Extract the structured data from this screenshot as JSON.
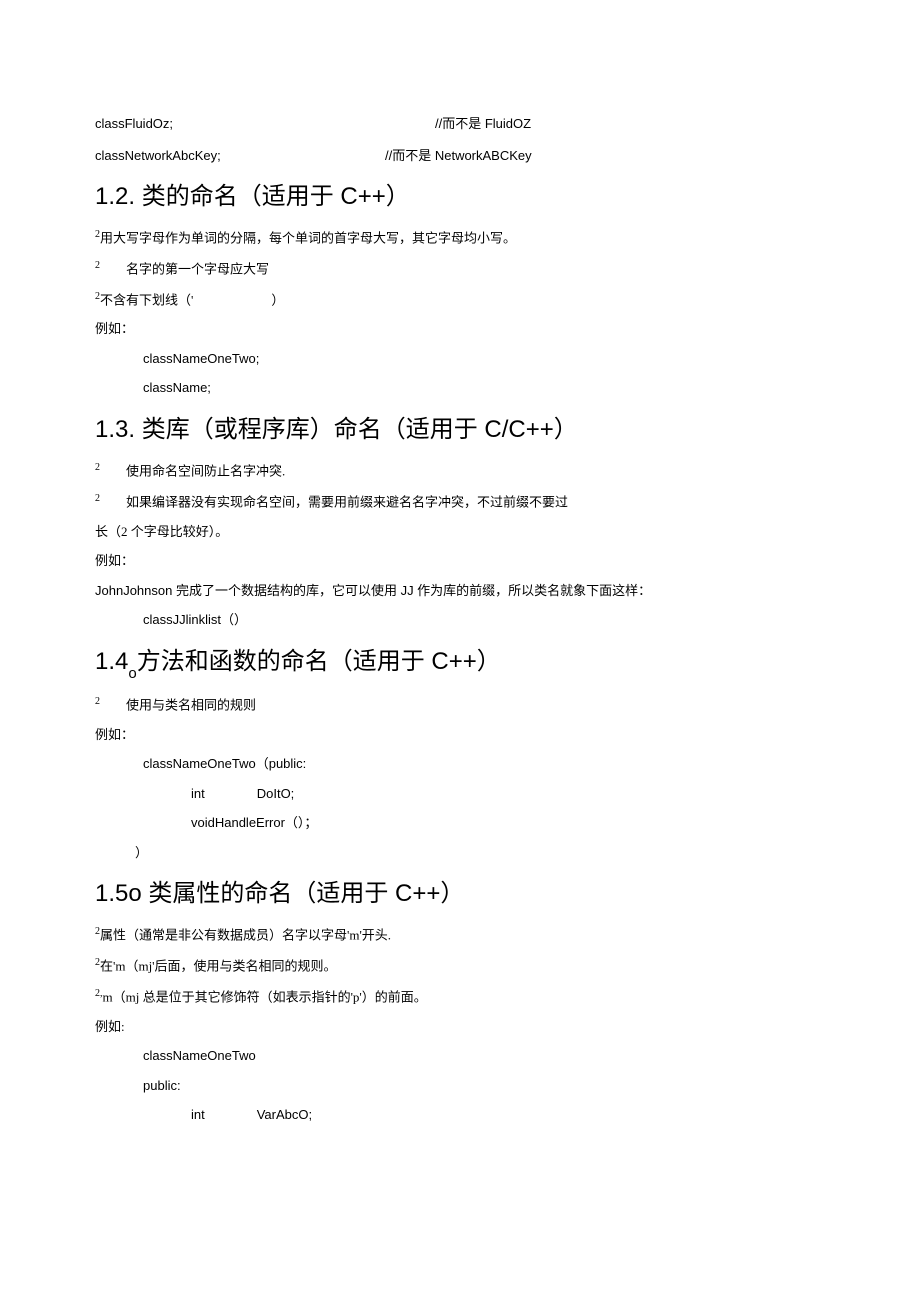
{
  "topLines": [
    {
      "left": "classFluidOz;",
      "right": "//而不是 FluidOZ"
    },
    {
      "left": "classNetworkAbcKey;",
      "right": "//而不是 NetworkABCKey"
    }
  ],
  "sections": [
    {
      "heading": "1.2. 类的命名（适用于 C++）",
      "lines": [
        {
          "text_pre": "2",
          "text": "用大写字母作为单词的分隔，每个单词的首字母大写，其它字母均小写。",
          "sup": true
        },
        {
          "text_pre": "2",
          "text": "　　名字的第一个字母应大写",
          "sup": true
        },
        {
          "text_pre": "2",
          "text": "不含有下划线（'　　　　　　）",
          "sup": true
        },
        {
          "text": "例如："
        },
        {
          "text": "classNameOneTwo;",
          "indent": 1,
          "mono": true
        },
        {
          "text": "className;",
          "indent": 1,
          "mono": true
        }
      ]
    },
    {
      "heading": "1.3. 类库（或程序库）命名（适用于 C/C++）",
      "lines": [
        {
          "text_pre": "2",
          "text": "　　使用命名空间防止名字冲突.",
          "sup": true
        },
        {
          "text_pre": "2",
          "text": "　　如果编译器没有实现命名空间，需要用前缀来避名名字冲突，不过前缀不要过",
          "sup": true
        },
        {
          "text": "长（2 个字母比较好）。"
        },
        {
          "text": "例如："
        },
        {
          "text": "JohnJohnson 完成了一个数据结构的库，它可以使用 JJ 作为库的前缀，所以类名就象下面这样：",
          "mixed": true
        },
        {
          "text": "classJJlinklist（）",
          "indent": 1,
          "mono": true
        }
      ]
    },
    {
      "heading_parts": [
        "1.4",
        "o",
        "方法和函数的命名（适用于 C++）"
      ],
      "lines": [
        {
          "text_pre": "2",
          "text": "　　使用与类名相同的规则",
          "sup": true
        },
        {
          "text": "例如："
        },
        {
          "text": "classNameOneTwo（public:",
          "indent": 1,
          "mono": true
        },
        {
          "text": "int　　　　DoItO;",
          "indent": 2,
          "mono": true
        },
        {
          "text": "voidHandleError（）；",
          "indent": 2,
          "mono": true
        },
        {
          "text": "）",
          "indent_bracket": true,
          "mono": true
        }
      ]
    },
    {
      "heading_parts": [
        "1.5o",
        "",
        " 类属性的命名（适用于 C++）"
      ],
      "lines": [
        {
          "text_pre": "2",
          "text": "属性（通常是非公有数据成员）名字以字母'm'开头.",
          "sup": true
        },
        {
          "text_pre": "2",
          "text": "在'm（mj'后面，使用与类名相同的规则。",
          "sup": true
        },
        {
          "text_pre": "2,",
          "text": "m（mj 总是位于其它修饰符（如表示指针的'p'）的前面。",
          "sup": true
        },
        {
          "text": "例如:"
        },
        {
          "text": "classNameOneTwo",
          "indent": 1,
          "mono": true
        },
        {
          "text": " ",
          "indent": 1
        },
        {
          "text": "public:",
          "indent": 1,
          "mono": true
        },
        {
          "text": "int　　　　VarAbcO;",
          "indent": 2,
          "mono": true
        }
      ]
    }
  ]
}
